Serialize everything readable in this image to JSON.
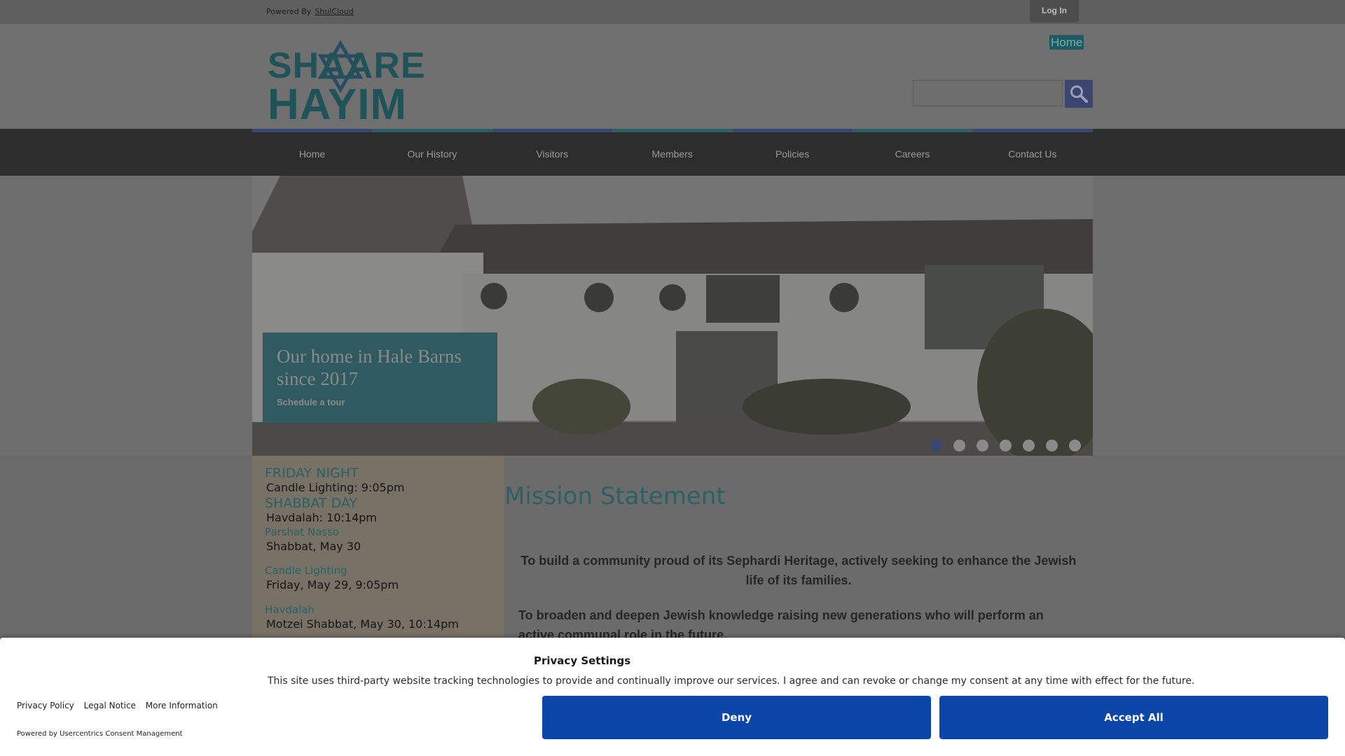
{
  "topbar": {
    "powered_label": "Powered By",
    "powered_link": "ShulCloud",
    "login_label": "Log In"
  },
  "header": {
    "logo_line1": "SHAARE",
    "logo_line2": "HAYIM",
    "home_link": "Home",
    "search": {
      "value": "",
      "placeholder": ""
    }
  },
  "nav": {
    "items": [
      "Home",
      "Our History",
      "Visitors",
      "Members",
      "Policies",
      "Careers",
      "Contact Us"
    ],
    "stripe_colors": [
      "#3b4670",
      "#2d6066",
      "#3b4670",
      "#2d6066",
      "#3b4670",
      "#2d6066",
      "#3b4670"
    ]
  },
  "hero": {
    "caption_title": "Our home in Hale Barns since 2017",
    "caption_link": "Schedule a tour",
    "slide_count": 7,
    "active_slide": 1
  },
  "sidebar": {
    "friday_heading": "FRIDAY NIGHT",
    "friday_candle": "Candle Lighting: 9:05pm",
    "shabbat_heading": "SHABBAT DAY",
    "shabbat_havdalah": "Havdalah: 10:14pm",
    "parsha_heading": "Parshat Nasso",
    "parsha_date": "Shabbat, May 30",
    "candle_heading": "Candle Lighting",
    "candle_date": "Friday, May 29, 9:05pm",
    "havdalah_heading": "Havdalah",
    "havdalah_date": "Motzei Shabbat, May 30, 10:14pm"
  },
  "main": {
    "title": "Mission Statement",
    "para1": "To build a community proud of its Sephardi Heritage, actively seeking to enhance the Jewish life of its families.",
    "para2": "To broaden and deepen Jewish knowledge raising new generations who will perform an active communal role in the future."
  },
  "consent": {
    "title": "Privacy Settings",
    "text": "This site uses third-party website tracking technologies to provide and continually improve our services. I agree and can revoke or change my consent at any time with effect for the future.",
    "links": [
      "Privacy Policy",
      "Legal Notice",
      "More Information"
    ],
    "powered": "Powered by Usercentrics Consent Management",
    "deny_label": "Deny",
    "accept_label": "Accept All",
    "button_color": "#0a47a8"
  }
}
